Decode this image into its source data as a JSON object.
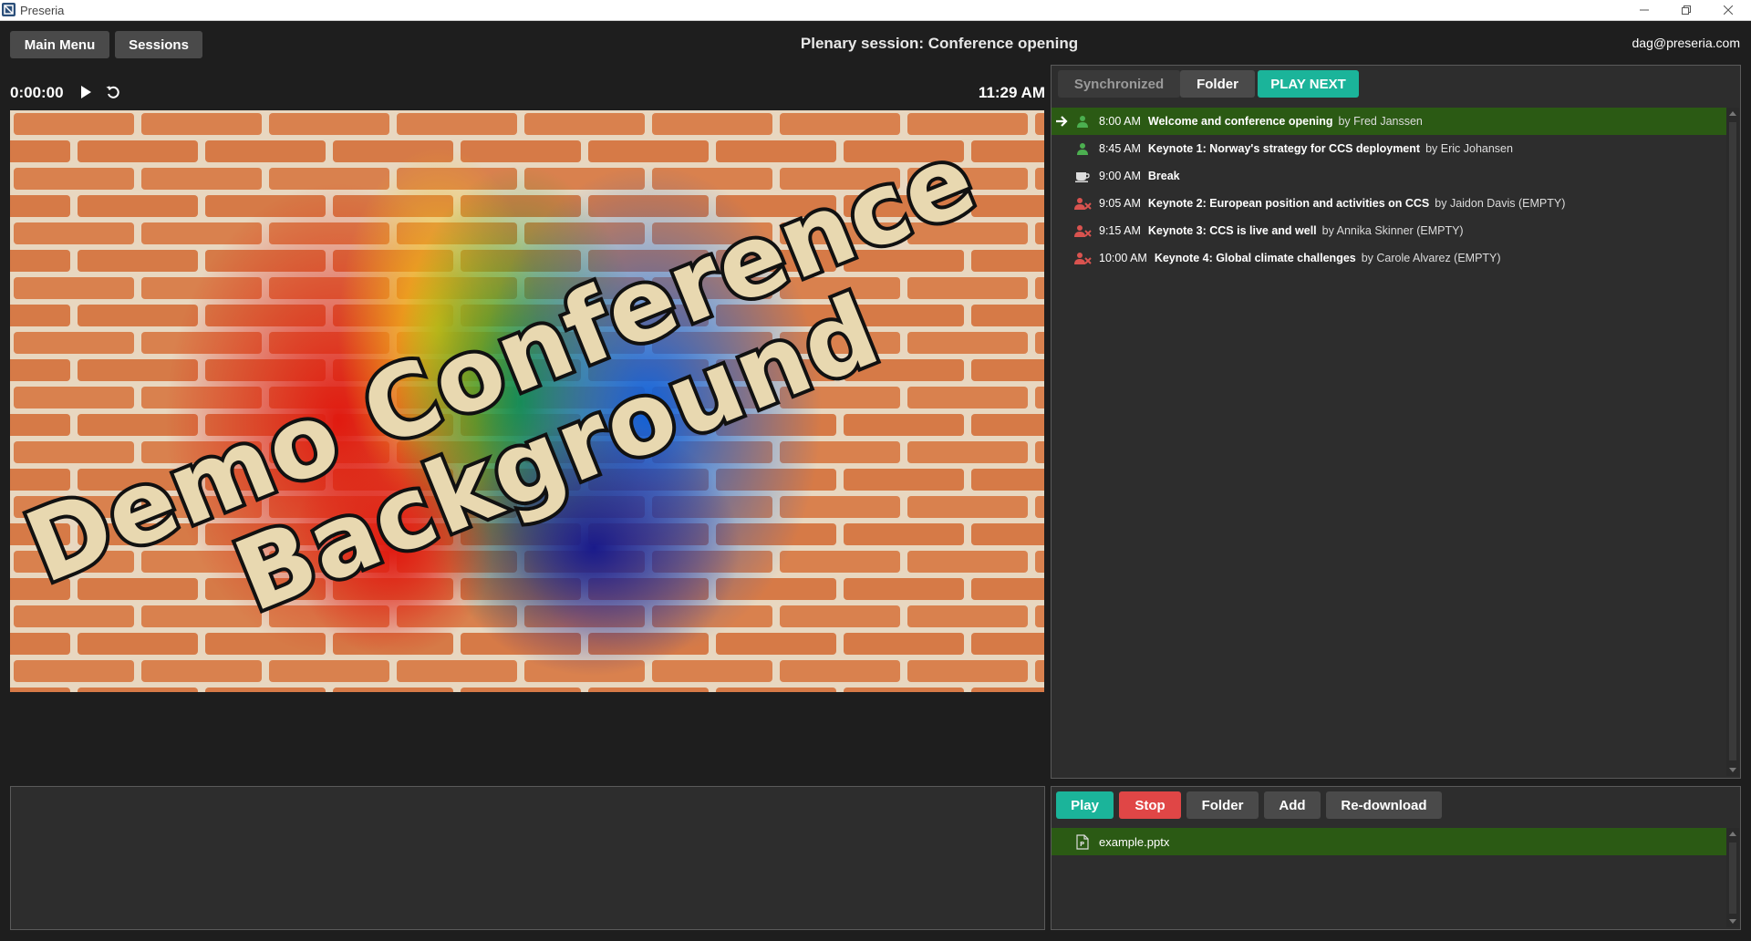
{
  "window": {
    "title": "Preseria"
  },
  "header": {
    "main_menu_label": "Main Menu",
    "sessions_label": "Sessions",
    "session_title": "Plenary session: Conference opening",
    "user_email": "dag@preseria.com"
  },
  "player": {
    "timecode": "0:00:00",
    "clock": "11:29 AM",
    "preview": {
      "line1": "Demo Conference",
      "line2": "Background"
    }
  },
  "tabs": {
    "synchronized_label": "Synchronized",
    "folder_label": "Folder",
    "play_next_label": "PLAY NEXT"
  },
  "schedule": [
    {
      "time": "8:00 AM",
      "title": "Welcome and conference opening",
      "by": "by Fred Janssen",
      "status_icon": "person-icon",
      "active": true
    },
    {
      "time": "8:45 AM",
      "title": "Keynote 1: Norway's strategy for CCS deployment",
      "by": "by Eric Johansen",
      "status_icon": "person-icon",
      "active": false
    },
    {
      "time": "9:00 AM",
      "title": "Break",
      "by": "",
      "status_icon": "coffee-cup-icon",
      "active": false
    },
    {
      "time": "9:05 AM",
      "title": "Keynote 2: European position and activities on CCS",
      "by": "by Jaidon Davis (EMPTY)",
      "status_icon": "person-missing-icon",
      "active": false
    },
    {
      "time": "9:15 AM",
      "title": "Keynote 3: CCS is live and well",
      "by": "by Annika Skinner (EMPTY)",
      "status_icon": "person-missing-icon",
      "active": false
    },
    {
      "time": "10:00 AM",
      "title": "Keynote 4: Global climate challenges",
      "by": "by Carole Alvarez (EMPTY)",
      "status_icon": "person-missing-icon",
      "active": false
    }
  ],
  "file_controls": {
    "play_label": "Play",
    "stop_label": "Stop",
    "folder_label": "Folder",
    "add_label": "Add",
    "redownload_label": "Re-download"
  },
  "files": [
    {
      "name": "example.pptx",
      "icon": "document-icon"
    }
  ],
  "colors": {
    "accent_teal": "#1bb49a",
    "stop_red": "#e04646",
    "active_row_green": "#2b5a14",
    "person_ok_green": "#4caf50",
    "person_missing_red": "#d9534f"
  }
}
